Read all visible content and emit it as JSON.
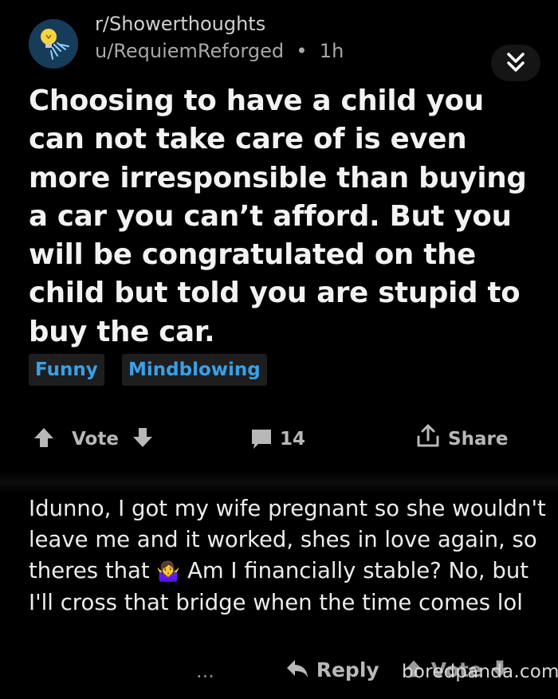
{
  "post": {
    "subreddit": "r/Showerthoughts",
    "user": "u/RequiemReforged",
    "age": "1h",
    "title": "Choosing to have a child you can not take care of is even more irresponsible than buying a car you can’t afford. But you will be congratulated on the child but told you are stupid to buy the car.",
    "flairs": [
      "Funny",
      "Mindblowing"
    ],
    "vote_label": "Vote",
    "comment_count": "14",
    "share_label": "Share",
    "icons": [
      "shower-avatar-icon",
      "double-chevron-down-icon",
      "upvote-arrow-icon",
      "downvote-arrow-icon",
      "comment-bubble-icon",
      "share-icon"
    ]
  },
  "comment": {
    "text_part1": "Idunno, I got my wife pregnant so she wouldn't leave me and it worked, shes in love again, so theres that",
    "emoji": "🤷‍♀️",
    "text_part2": "Am I financially stable? No, but I'll cross that bridge when the time comes lol",
    "more_label": "...",
    "reply_label": "Reply",
    "vote_label": "Vote",
    "icons": [
      "reply-arrow-icon",
      "shrug-emoji-icon"
    ]
  },
  "watermark": "boredpanda.com",
  "colors": {
    "accent": "#3aa0e8",
    "background": "#000000",
    "chip": "#1e1e1e"
  }
}
